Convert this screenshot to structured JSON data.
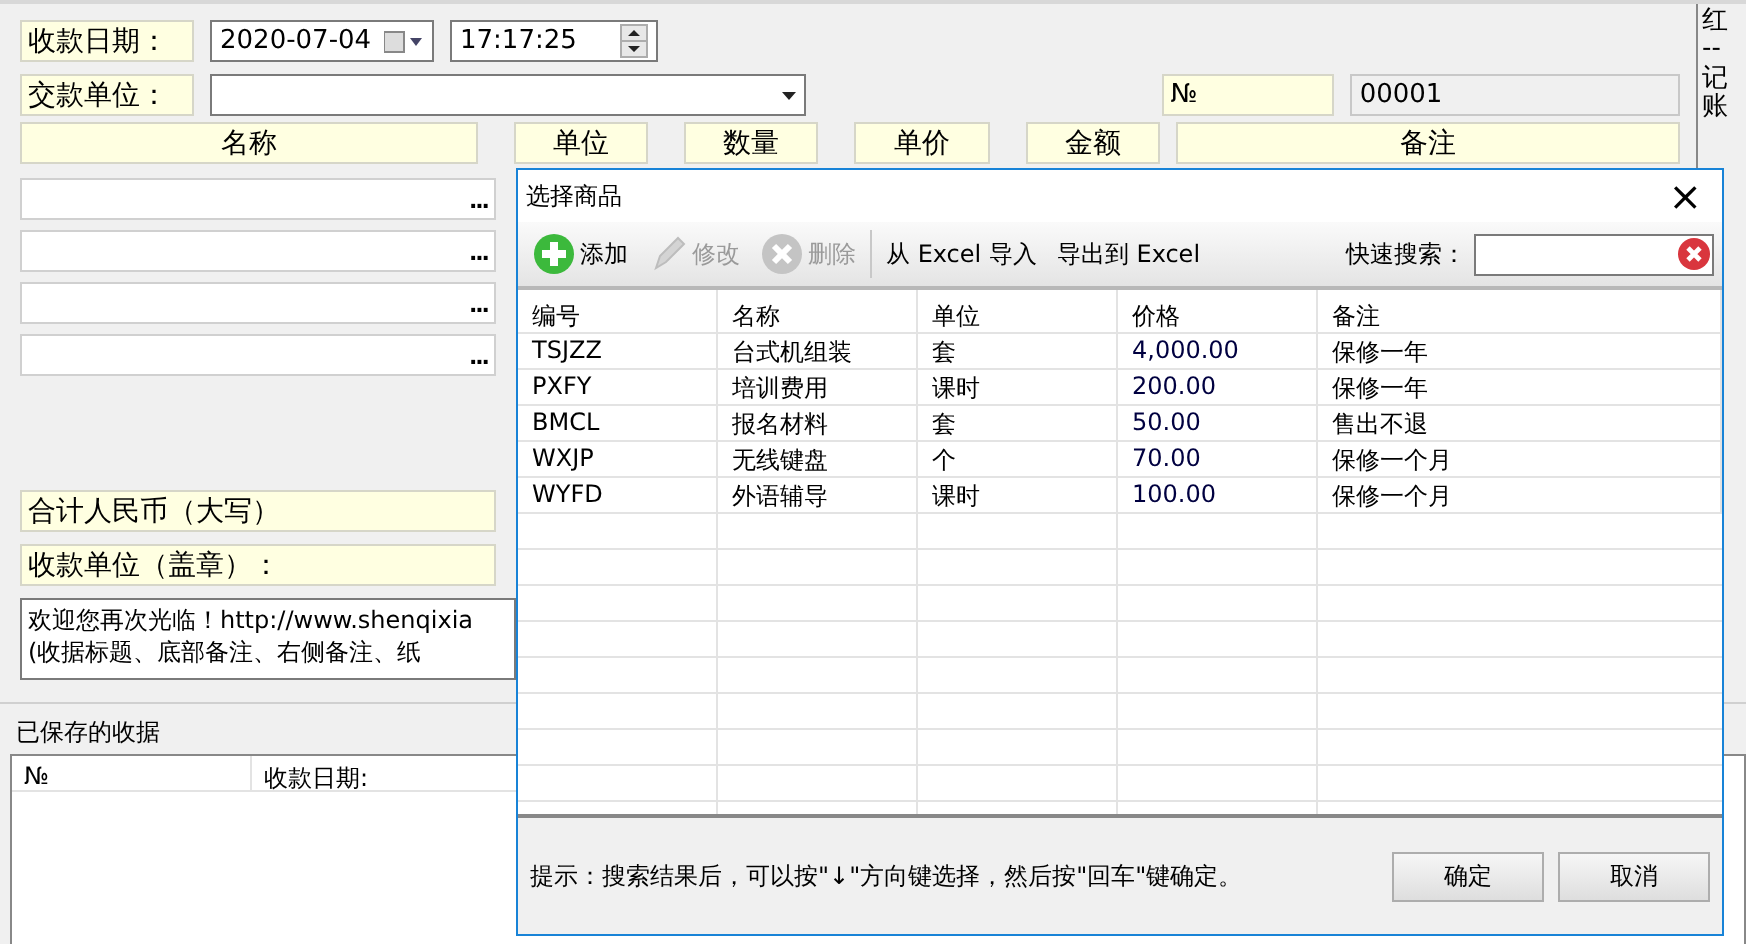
{
  "receipt_form": {
    "date_label": "收款日期：",
    "date_value": "2020-07-04",
    "time_value": "17:17:25",
    "payer_label": "交款单位：",
    "number_label": "№",
    "number_value": "00001",
    "item_columns": [
      "名称",
      "单位",
      "数量",
      "单价",
      "金额",
      "备注"
    ],
    "item_rows": [
      {
        "browse": "..."
      },
      {
        "browse": "..."
      },
      {
        "browse": "..."
      },
      {
        "browse": "..."
      }
    ],
    "total_label": "合计人民币（大写）",
    "payee_label": "收款单位（盖章）：",
    "footer_note": [
      "欢迎您再次光临！http://www.shenqixia",
      "(收据标题、底部备注、右侧备注、纸"
    ],
    "side_note": "红--记账"
  },
  "saved_receipts": {
    "title": "已保存的收据",
    "columns": [
      "№",
      "收款日期:"
    ]
  },
  "dialog": {
    "title": "选择商品",
    "close": "×",
    "toolbar": [
      {
        "kind": "add",
        "label": "添加",
        "disabled": false
      },
      {
        "kind": "edit",
        "label": "修改",
        "disabled": true
      },
      {
        "kind": "delete",
        "label": "删除",
        "disabled": true
      },
      {
        "kind": "separator"
      },
      {
        "kind": "text",
        "label": "从 Excel 导入",
        "disabled": false
      },
      {
        "kind": "text",
        "label": "导出到 Excel",
        "disabled": false
      }
    ],
    "search_label": "快速搜索：",
    "columns": [
      "编号",
      "名称",
      "单位",
      "价格",
      "备注"
    ],
    "rows": [
      [
        "TSJZZ",
        "台式机组装",
        "套",
        "4,000.00",
        "保修一年"
      ],
      [
        "PXFY",
        "培训费用",
        "课时",
        "200.00",
        "保修一年"
      ],
      [
        "BMCL",
        "报名材料",
        "套",
        "50.00",
        "售出不退"
      ],
      [
        "WXJP",
        "无线键盘",
        "个",
        "70.00",
        "保修一个月"
      ],
      [
        "WYFD",
        "外语辅导",
        "课时",
        "100.00",
        "保修一个月"
      ]
    ],
    "hint": "提示：搜索结果后，可以按\"↓\"方向键选择，然后按\"回车\"键确定。",
    "buttons": [
      "确定",
      "取消"
    ]
  }
}
